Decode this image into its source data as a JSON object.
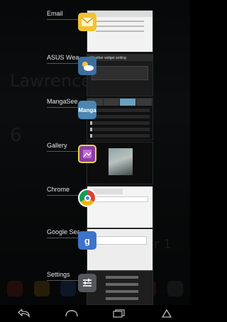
{
  "wallpaper": {
    "city_text": "Lawrence",
    "temp_text": "6",
    "date_text": "ar 1"
  },
  "recents": [
    {
      "label": "Email",
      "icon": "email-icon",
      "thumbnail": "email-thumbnail"
    },
    {
      "label": "ASUS Weat",
      "icon": "weather-icon",
      "thumbnail": "weather-widget-thumbnail",
      "thumb_text": "Weather widget setting"
    },
    {
      "label": "MangaSee",
      "icon": "manga-icon",
      "thumbnail": "manga-thumbnail",
      "icon_text": "Manga"
    },
    {
      "label": "Gallery",
      "icon": "gallery-icon",
      "thumbnail": "gallery-thumbnail"
    },
    {
      "label": "Chrome",
      "icon": "chrome-icon",
      "thumbnail": "chrome-thumbnail"
    },
    {
      "label": "Google Sea",
      "icon": "google-search-icon",
      "thumbnail": "google-search-thumbnail",
      "icon_text": "g"
    },
    {
      "label": "Settings",
      "icon": "settings-icon",
      "thumbnail": "settings-thumbnail"
    }
  ],
  "navbar": {
    "back": "back-icon",
    "home": "home-icon",
    "recents": "recent-apps-icon",
    "menu": "menu-icon"
  }
}
